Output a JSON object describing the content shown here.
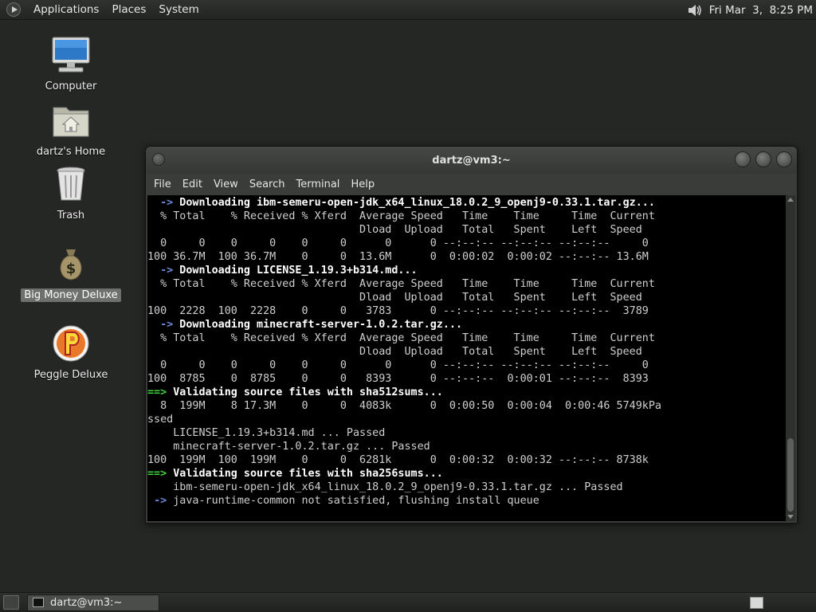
{
  "top_panel": {
    "menus": [
      "Applications",
      "Places",
      "System"
    ],
    "clock": "Fri Mar  3,  8:25 PM",
    "icons": {
      "menu": "gnome-foot-icon",
      "volume": "volume-icon"
    }
  },
  "desktop": {
    "icons": [
      {
        "label": "Computer",
        "icon": "computer-icon"
      },
      {
        "label": "dartz's Home",
        "icon": "home-folder-icon"
      },
      {
        "label": "Trash",
        "icon": "trash-icon"
      },
      {
        "label": "Big Money Deluxe",
        "icon": "money-bag-icon",
        "selected": true
      },
      {
        "label": "Peggle Deluxe",
        "icon": "peggle-icon"
      }
    ]
  },
  "terminal": {
    "title": "dartz@vm3:~",
    "menu": [
      "File",
      "Edit",
      "View",
      "Search",
      "Terminal",
      "Help"
    ],
    "lines": [
      "  -> Downloading ibm-semeru-open-jdk_x64_linux_18.0.2_9_openj9-0.33.1.tar.gz...",
      "  % Total    % Received % Xferd  Average Speed   Time    Time     Time  Current",
      "                                 Dload  Upload   Total   Spent    Left  Speed",
      "  0     0    0     0    0     0      0      0 --:--:-- --:--:-- --:--:--     0",
      "100 36.7M  100 36.7M    0     0  13.6M      0  0:00:02  0:00:02 --:--:-- 13.6M",
      "  -> Downloading LICENSE_1.19.3+b314.md...",
      "  % Total    % Received % Xferd  Average Speed   Time    Time     Time  Current",
      "                                 Dload  Upload   Total   Spent    Left  Speed",
      "100  2228  100  2228    0     0   3783      0 --:--:-- --:--:-- --:--:--  3789",
      "  -> Downloading minecraft-server-1.0.2.tar.gz...",
      "  % Total    % Received % Xferd  Average Speed   Time    Time     Time  Current",
      "                                 Dload  Upload   Total   Spent    Left  Speed",
      "  0     0    0     0    0     0      0      0 --:--:-- --:--:-- --:--:--     0",
      "100  8785    0  8785    0     0   8393      0 --:--:--  0:00:01 --:--:--  8393",
      "==> Validating source files with sha512sums...",
      "  8  199M    8 17.3M    0     0  4083k      0  0:00:50  0:00:04  0:00:46 5749kPa",
      "ssed",
      "    LICENSE_1.19.3+b314.md ... Passed",
      "    minecraft-server-1.0.2.tar.gz ... Passed",
      "100  199M  100  199M    0     0  6281k      0  0:00:32  0:00:32 --:--:-- 8738k",
      "==> Validating source files with sha256sums...",
      "    ibm-semeru-open-jdk_x64_linux_18.0.2_9_openj9-0.33.1.tar.gz ... Passed",
      " -> java-runtime-common not satisfied, flushing install queue"
    ],
    "bold_lines": [
      0,
      5,
      9,
      14,
      20
    ],
    "colors": {
      "arrow_blue": "#6a8ad8",
      "arrow_green": "#3fd33f",
      "text": "#cfcfcf",
      "background": "#000000"
    }
  },
  "taskbar": {
    "tasks": [
      {
        "label": "dartz@vm3:~",
        "icon": "terminal-icon"
      }
    ]
  }
}
